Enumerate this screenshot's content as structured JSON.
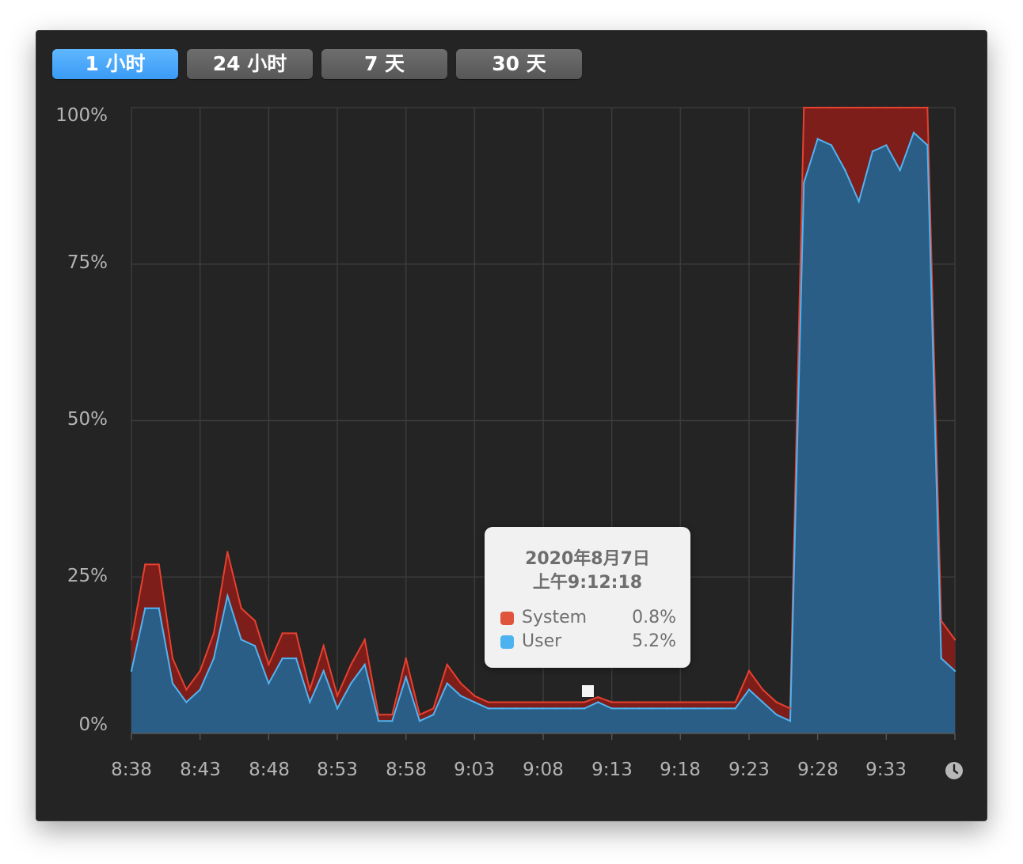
{
  "tabs": [
    {
      "label": "1 小时",
      "active": true
    },
    {
      "label": "24 小时",
      "active": false
    },
    {
      "label": "7 天",
      "active": false
    },
    {
      "label": "30 天",
      "active": false
    }
  ],
  "colors": {
    "system": "#e8402f",
    "system_fill": "#7d1e1a",
    "user": "#4fb4f2",
    "user_fill": "#2a5e86",
    "active_tab": "#4aa8fb",
    "background": "#242424"
  },
  "tooltip": {
    "date": "2020年8月7日",
    "time": "上午9:12:18",
    "rows": [
      {
        "name": "System",
        "value": "0.8%",
        "color": "#e0533d"
      },
      {
        "name": "User",
        "value": "5.2%",
        "color": "#4cb2f0"
      }
    ]
  },
  "clock_icon": "clock-icon",
  "chart_data": {
    "type": "area",
    "stacked": true,
    "x_unit": "time",
    "xlim": [
      "8:38",
      "9:38"
    ],
    "ylim": [
      0,
      100
    ],
    "y_ticks": [
      "0%",
      "25%",
      "50%",
      "75%",
      "100%"
    ],
    "x_ticks": [
      "8:38",
      "8:43",
      "8:48",
      "8:53",
      "8:58",
      "9:03",
      "9:08",
      "9:13",
      "9:18",
      "9:23",
      "9:28",
      "9:33"
    ],
    "grid": true,
    "series": [
      {
        "name": "User",
        "color": "#4fb4f2",
        "x": [
          "8:38",
          "8:39",
          "8:40",
          "8:41",
          "8:42",
          "8:43",
          "8:44",
          "8:45",
          "8:46",
          "8:47",
          "8:48",
          "8:49",
          "8:50",
          "8:51",
          "8:52",
          "8:53",
          "8:54",
          "8:55",
          "8:56",
          "8:57",
          "8:58",
          "8:59",
          "9:00",
          "9:01",
          "9:02",
          "9:03",
          "9:04",
          "9:05",
          "9:06",
          "9:07",
          "9:08",
          "9:09",
          "9:10",
          "9:11",
          "9:12",
          "9:13",
          "9:14",
          "9:15",
          "9:16",
          "9:17",
          "9:18",
          "9:19",
          "9:20",
          "9:21",
          "9:22",
          "9:23",
          "9:24",
          "9:25",
          "9:26",
          "9:27",
          "9:28",
          "9:29",
          "9:30",
          "9:31",
          "9:32",
          "9:33",
          "9:34",
          "9:35",
          "9:36",
          "9:37",
          "9:38"
        ],
        "values": [
          10,
          20,
          20,
          8,
          5,
          7,
          12,
          22,
          15,
          14,
          8,
          12,
          12,
          5,
          10,
          4,
          8,
          11,
          2,
          2,
          9,
          2,
          3,
          8,
          6,
          5,
          4,
          4,
          4,
          4,
          4,
          4,
          4,
          4,
          5,
          4,
          4,
          4,
          4,
          4,
          4,
          4,
          4,
          4,
          4,
          7,
          5,
          3,
          2,
          88,
          95,
          94,
          90,
          85,
          93,
          94,
          90,
          96,
          94,
          12,
          10
        ]
      },
      {
        "name": "System",
        "color": "#e8402f",
        "x": [
          "8:38",
          "8:39",
          "8:40",
          "8:41",
          "8:42",
          "8:43",
          "8:44",
          "8:45",
          "8:46",
          "8:47",
          "8:48",
          "8:49",
          "8:50",
          "8:51",
          "8:52",
          "8:53",
          "8:54",
          "8:55",
          "8:56",
          "8:57",
          "8:58",
          "8:59",
          "9:00",
          "9:01",
          "9:02",
          "9:03",
          "9:04",
          "9:05",
          "9:06",
          "9:07",
          "9:08",
          "9:09",
          "9:10",
          "9:11",
          "9:12",
          "9:13",
          "9:14",
          "9:15",
          "9:16",
          "9:17",
          "9:18",
          "9:19",
          "9:20",
          "9:21",
          "9:22",
          "9:23",
          "9:24",
          "9:25",
          "9:26",
          "9:27",
          "9:28",
          "9:29",
          "9:30",
          "9:31",
          "9:32",
          "9:33",
          "9:34",
          "9:35",
          "9:36",
          "9:37",
          "9:38"
        ],
        "values": [
          5,
          7,
          7,
          4,
          2,
          3,
          4,
          7,
          5,
          4,
          3,
          4,
          4,
          2,
          4,
          2,
          3,
          4,
          1,
          1,
          3,
          1,
          1,
          3,
          2,
          1,
          1,
          1,
          1,
          1,
          1,
          1,
          1,
          1,
          0.8,
          1,
          1,
          1,
          1,
          1,
          1,
          1,
          1,
          1,
          1,
          3,
          2,
          2,
          2,
          12,
          5,
          6,
          10,
          15,
          7,
          6,
          10,
          4,
          6,
          6,
          5
        ]
      }
    ]
  }
}
